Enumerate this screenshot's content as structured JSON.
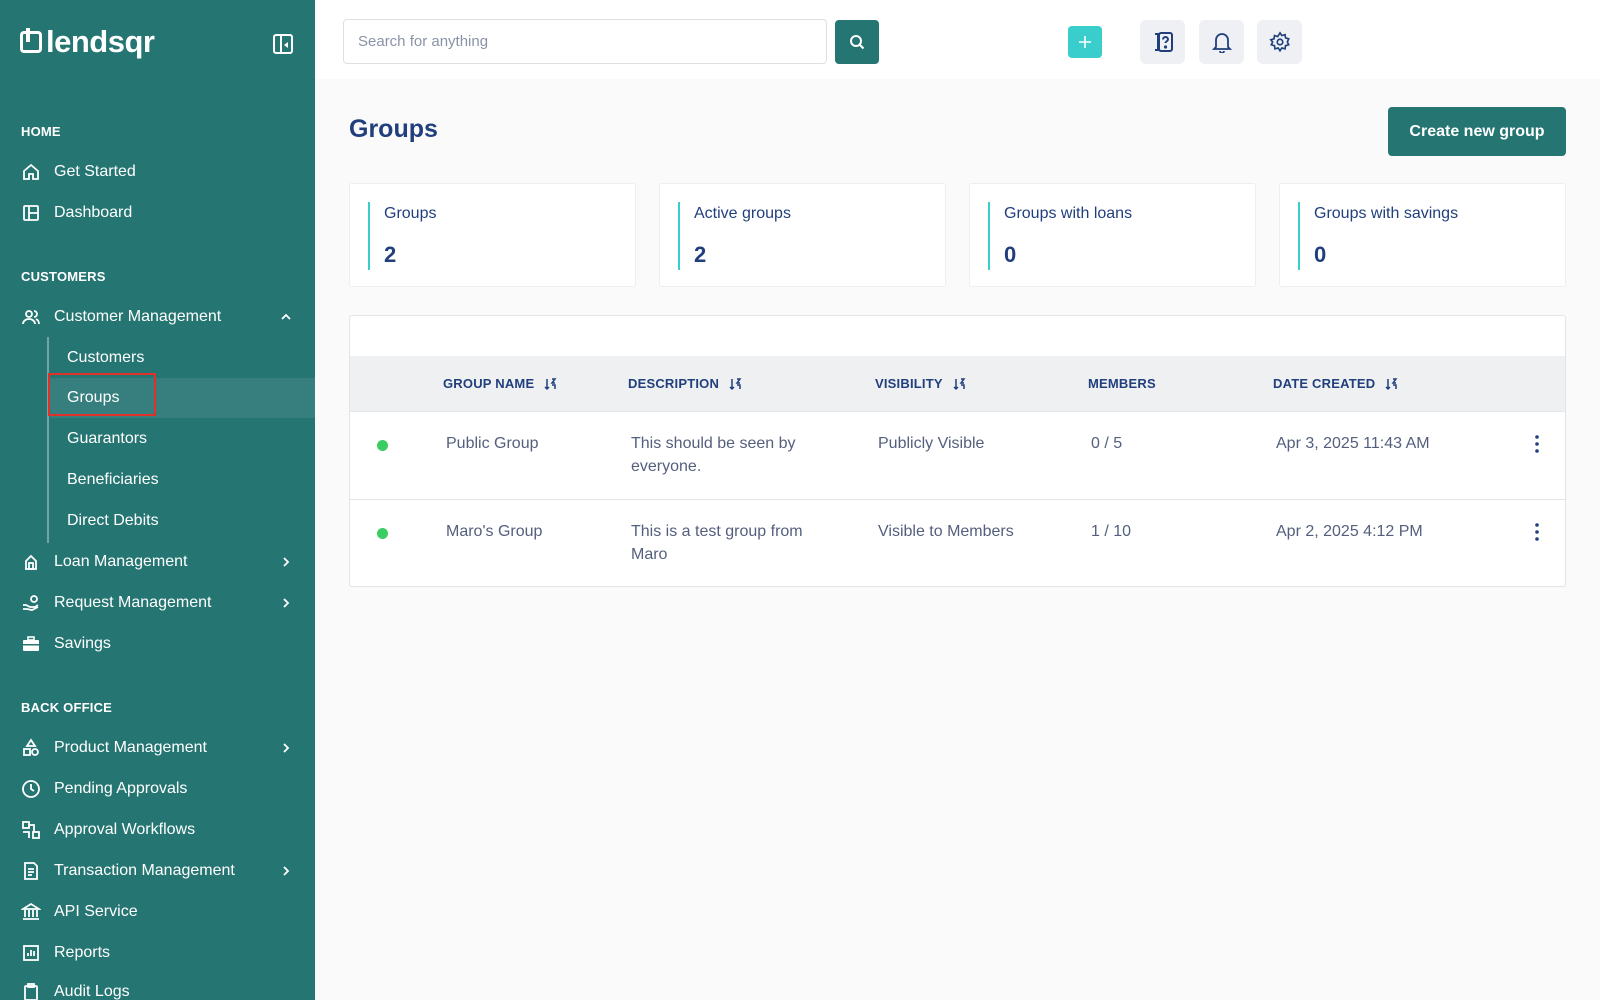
{
  "app": {
    "logo_text": "lendsqr"
  },
  "sidebar": {
    "sections": {
      "home": "HOME",
      "customers": "CUSTOMERS",
      "back_office": "BACK OFFICE"
    },
    "home_items": [
      {
        "label": "Get Started",
        "icon": "home-icon"
      },
      {
        "label": "Dashboard",
        "icon": "dashboard-icon"
      }
    ],
    "customer_management": {
      "label": "Customer Management",
      "icon": "users-icon",
      "expanded": true
    },
    "customer_sub_items": [
      {
        "label": "Customers"
      },
      {
        "label": "Groups",
        "active": true
      },
      {
        "label": "Guarantors"
      },
      {
        "label": "Beneficiaries"
      },
      {
        "label": "Direct Debits"
      }
    ],
    "customer_items": [
      {
        "label": "Loan Management",
        "icon": "loan-icon"
      },
      {
        "label": "Request Management",
        "icon": "request-icon"
      },
      {
        "label": "Savings",
        "icon": "savings-icon"
      }
    ],
    "back_office_items": [
      {
        "label": "Product Management",
        "icon": "product-icon"
      },
      {
        "label": "Pending Approvals",
        "icon": "clock-icon"
      },
      {
        "label": "Approval Workflows",
        "icon": "workflow-icon"
      },
      {
        "label": "Transaction Management",
        "icon": "transaction-icon"
      },
      {
        "label": "API Service",
        "icon": "bank-icon"
      },
      {
        "label": "Reports",
        "icon": "reports-icon"
      },
      {
        "label": "Audit Logs",
        "icon": "audit-icon"
      }
    ]
  },
  "topbar": {
    "search_placeholder": "Search for anything"
  },
  "page": {
    "title": "Groups",
    "create_button": "Create new group"
  },
  "stats": [
    {
      "label": "Groups",
      "value": "2"
    },
    {
      "label": "Active groups",
      "value": "2"
    },
    {
      "label": "Groups with loans",
      "value": "0"
    },
    {
      "label": "Groups with savings",
      "value": "0"
    }
  ],
  "table": {
    "columns": [
      "GROUP NAME",
      "DESCRIPTION",
      "VISIBILITY",
      "MEMBERS",
      "DATE CREATED"
    ],
    "rows": [
      {
        "name": "Public Group",
        "description": "This should be seen by everyone.",
        "visibility": "Publicly Visible",
        "members": "0 / 5",
        "date": "Apr 3, 2025 11:43 AM",
        "status_color": "#39cd62"
      },
      {
        "name": "Maro's Group",
        "description": "This is a test group from Maro",
        "visibility": "Visible to Members",
        "members": "1 / 10",
        "date": "Apr 2, 2025 4:12 PM",
        "status_color": "#39cd62"
      }
    ]
  },
  "colors": {
    "sidebar_bg": "#257573",
    "accent": "#39cdcc",
    "title": "#213f7d",
    "status_active": "#39cd62"
  }
}
